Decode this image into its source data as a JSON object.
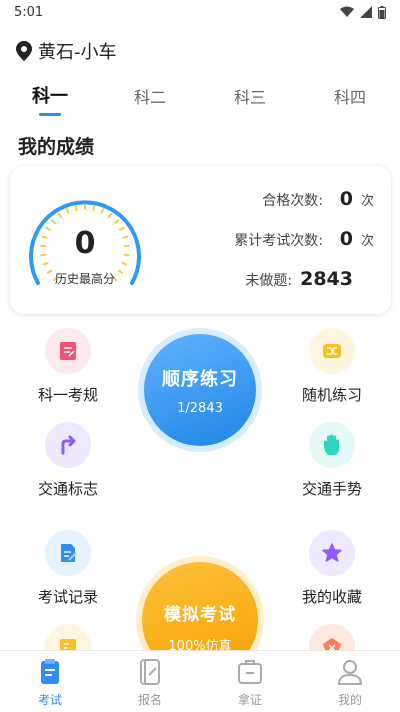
{
  "status_bar": {
    "time": "5:01"
  },
  "location": {
    "text": "黄石-小车"
  },
  "tabs": [
    {
      "label": "科一",
      "active": true
    },
    {
      "label": "科二",
      "active": false
    },
    {
      "label": "科三",
      "active": false
    },
    {
      "label": "科四",
      "active": false
    }
  ],
  "section_title": "我的成绩",
  "score": {
    "value": "0",
    "label": "历史最高分",
    "stats": [
      {
        "label": "合格次数:",
        "value": "0",
        "unit": "次"
      },
      {
        "label": "累计考试次数:",
        "value": "0",
        "unit": "次"
      },
      {
        "label": "未做题:",
        "value": "2843",
        "unit": ""
      }
    ]
  },
  "features": {
    "left": [
      {
        "label": "科一考规",
        "icon": "rules-book-icon",
        "color": "#f5527a",
        "bg": "#ffe9ef"
      },
      {
        "label": "交通标志",
        "icon": "turn-sign-icon",
        "color": "#8b5cf6",
        "bg": "#efe9ff"
      },
      {
        "label": "考试记录",
        "icon": "record-document-icon",
        "color": "#2f8cf5",
        "bg": "#e6f2ff"
      }
    ],
    "right": [
      {
        "label": "随机练习",
        "icon": "shuffle-icon",
        "color": "#fbbf24",
        "bg": "#fff6e0"
      },
      {
        "label": "交通手势",
        "icon": "hand-gesture-icon",
        "color": "#2dd4bf",
        "bg": "#e3faf6"
      },
      {
        "label": "我的收藏",
        "icon": "star-icon",
        "color": "#8b5cf6",
        "bg": "#efe9ff"
      }
    ]
  },
  "sequence": {
    "title": "顺序练习",
    "progress": "1/2843"
  },
  "mock_exam": {
    "title": "模拟考试",
    "subtitle": "100%仿真"
  },
  "bottom_nav": [
    {
      "label": "考试",
      "active": true
    },
    {
      "label": "报名",
      "active": false
    },
    {
      "label": "拿证",
      "active": false
    },
    {
      "label": "我的",
      "active": false
    }
  ],
  "colors": {
    "accent": "#2f8cf5",
    "gold": "#f5a000"
  }
}
